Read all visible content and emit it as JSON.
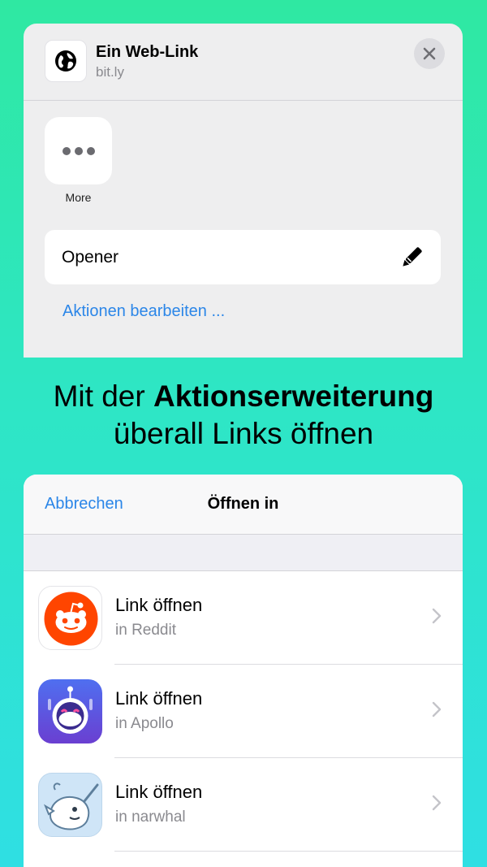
{
  "share_sheet": {
    "link_title": "Ein Web-Link",
    "link_host": "bit.ly",
    "more_label": "More",
    "action_label": "Opener",
    "edit_actions_label": "Aktionen bearbeiten ..."
  },
  "headline": {
    "prefix": "Mit der ",
    "bold": "Aktionserweiterung",
    "line2": "überall Links öffnen"
  },
  "open_sheet": {
    "cancel_label": "Abbrechen",
    "title": "Öffnen in",
    "rows": [
      {
        "title": "Link öffnen",
        "subtitle": "in Reddit",
        "icon": "reddit-icon"
      },
      {
        "title": "Link öffnen",
        "subtitle": "in Apollo",
        "icon": "apollo-icon"
      },
      {
        "title": "Link öffnen",
        "subtitle": "in narwhal",
        "icon": "narwhal-icon"
      }
    ]
  },
  "colors": {
    "accent_blue": "#2b86e8",
    "background_top": "#2fe8a2",
    "background_bottom": "#2fdfe3",
    "reddit_orange": "#ff4500",
    "apollo_purple": "#5b57d6",
    "narwhal_blue": "#cfe5f7"
  }
}
